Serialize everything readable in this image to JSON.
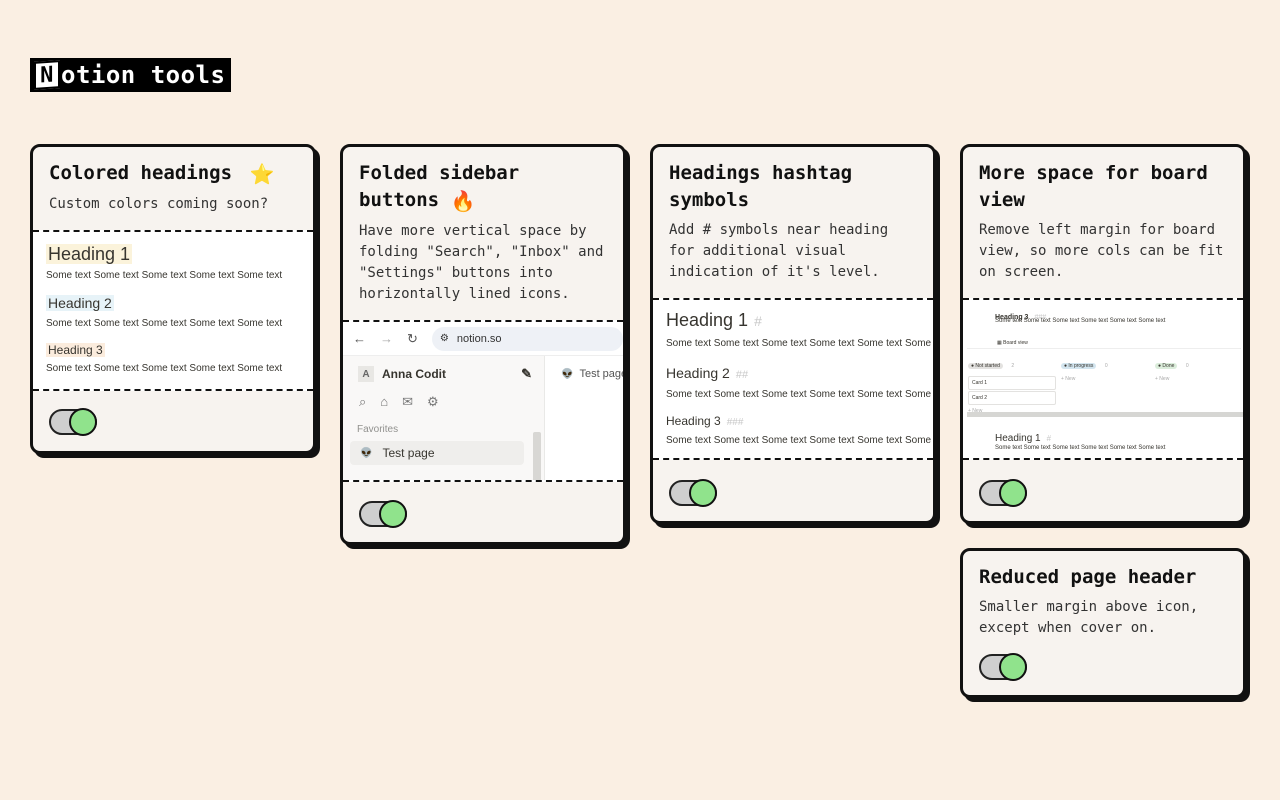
{
  "logo": {
    "n": "N",
    "text": "otion tools"
  },
  "cards": {
    "colored": {
      "title": "Colored headings",
      "emoji": "⭐",
      "desc": "Custom colors coming soon?",
      "preview": {
        "h1": "Heading 1",
        "h2": "Heading 2",
        "h3": "Heading 3",
        "text": "Some text Some text Some text Some text Some text",
        "h1_bg": "#fbf3db",
        "h2_bg": "#e7f3f8",
        "h3_bg": "#fbecdd"
      },
      "enabled": true
    },
    "sidebar": {
      "title": "Folded sidebar buttons",
      "emoji": "🔥",
      "desc": "Have more vertical space by folding \"Search\", \"Inbox\" and \"Settings\" buttons into horizontally lined icons.",
      "preview": {
        "url": "notion.so",
        "workspace_initial": "A",
        "workspace": "Anna Codit",
        "favorites": "Favorites",
        "page": "Test page",
        "tab_page": "Test page"
      },
      "enabled": true
    },
    "hashtag": {
      "title": "Headings hashtag symbols",
      "desc": "Add # symbols near heading for additional visual indication of it's level.",
      "preview": {
        "h1": "Heading 1",
        "h1_hash": "#",
        "h2": "Heading 2",
        "h2_hash": "##",
        "h3": "Heading 3",
        "h3_hash": "###",
        "text": "Some text Some text Some text Some text Some text Some text"
      },
      "enabled": true
    },
    "board": {
      "title": "More space for board view",
      "desc": "Remove left margin for board view, so more cols can be fit on screen.",
      "preview": {
        "h3": "Heading 3",
        "h3_hash": "###",
        "text": "Some text Some text Some text Some text Some text Some text",
        "view": "Board view",
        "col1": "Not started",
        "col1_count": "2",
        "col2": "In progress",
        "col2_count": "0",
        "col3": "Done",
        "col3_count": "0",
        "card1": "Card 1",
        "card2": "Card 2",
        "new": "+ New",
        "h1": "Heading 1",
        "h1_hash": "#"
      },
      "enabled": true
    },
    "header": {
      "title": "Reduced page header",
      "desc": "Smaller margin above icon, except when cover on.",
      "enabled": true
    }
  }
}
